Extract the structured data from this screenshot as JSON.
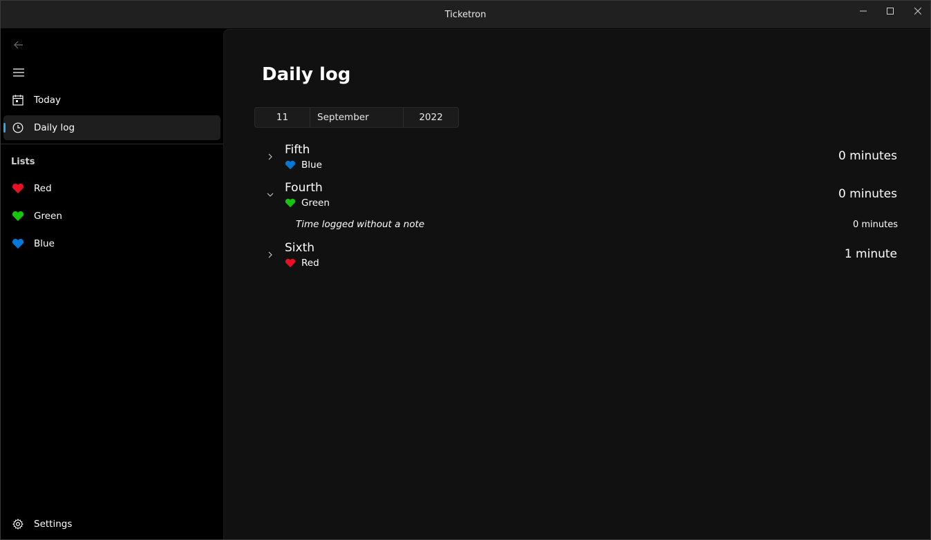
{
  "window": {
    "title": "Ticketron"
  },
  "sidebar": {
    "items": [
      {
        "label": "Today"
      },
      {
        "label": "Daily log"
      }
    ],
    "section_header": "Lists",
    "lists": [
      {
        "label": "Red",
        "color": "#e81123"
      },
      {
        "label": "Green",
        "color": "#16c60c"
      },
      {
        "label": "Blue",
        "color": "#0078d7"
      }
    ],
    "settings_label": "Settings"
  },
  "main": {
    "title": "Daily log",
    "date": {
      "day": "11",
      "month": "September",
      "year": "2022"
    },
    "entries": [
      {
        "title": "Fifth",
        "list": "Blue",
        "list_color": "#0078d7",
        "duration": "0 minutes",
        "expanded": false
      },
      {
        "title": "Fourth",
        "list": "Green",
        "list_color": "#16c60c",
        "duration": "0 minutes",
        "expanded": true,
        "notes": [
          {
            "text": "Time logged without a note",
            "duration": "0 minutes"
          }
        ]
      },
      {
        "title": "Sixth",
        "list": "Red",
        "list_color": "#e81123",
        "duration": "1 minute",
        "expanded": false
      }
    ]
  },
  "icons": {
    "back": "back-arrow-icon",
    "menu": "hamburger-menu-icon",
    "today": "calendar-icon",
    "daily_log": "clock-icon",
    "list": "heart-icon",
    "settings": "gear-icon",
    "collapsed": "chevron-right-icon",
    "expanded": "chevron-down-icon"
  },
  "colors": {
    "accent": "#38a4dc",
    "background": "#111111",
    "sidebar": "#000000"
  }
}
